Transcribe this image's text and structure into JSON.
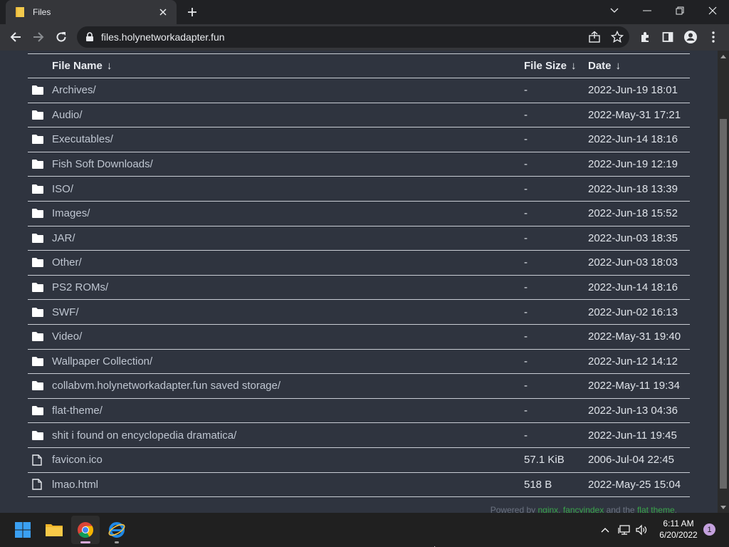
{
  "browser": {
    "tab": {
      "title": "Files"
    },
    "url": "files.holynetworkadapter.fun"
  },
  "listing": {
    "headers": {
      "name": "File Name",
      "size": "File Size",
      "date": "Date",
      "sort_arrow": "↓"
    },
    "rows": [
      {
        "type": "folder",
        "name": "Archives/",
        "size": "-",
        "date": "2022-Jun-19 18:01"
      },
      {
        "type": "folder",
        "name": "Audio/",
        "size": "-",
        "date": "2022-May-31 17:21"
      },
      {
        "type": "folder",
        "name": "Executables/",
        "size": "-",
        "date": "2022-Jun-14 18:16"
      },
      {
        "type": "folder",
        "name": "Fish Soft Downloads/",
        "size": "-",
        "date": "2022-Jun-19 12:19"
      },
      {
        "type": "folder",
        "name": "ISO/",
        "size": "-",
        "date": "2022-Jun-18 13:39"
      },
      {
        "type": "folder",
        "name": "Images/",
        "size": "-",
        "date": "2022-Jun-18 15:52"
      },
      {
        "type": "folder",
        "name": "JAR/",
        "size": "-",
        "date": "2022-Jun-03 18:35"
      },
      {
        "type": "folder",
        "name": "Other/",
        "size": "-",
        "date": "2022-Jun-03 18:03"
      },
      {
        "type": "folder",
        "name": "PS2 ROMs/",
        "size": "-",
        "date": "2022-Jun-14 18:16"
      },
      {
        "type": "folder",
        "name": "SWF/",
        "size": "-",
        "date": "2022-Jun-02 16:13"
      },
      {
        "type": "folder",
        "name": "Video/",
        "size": "-",
        "date": "2022-May-31 19:40"
      },
      {
        "type": "folder",
        "name": "Wallpaper Collection/",
        "size": "-",
        "date": "2022-Jun-12 14:12"
      },
      {
        "type": "folder",
        "name": "collabvm.holynetworkadapter.fun saved storage/",
        "size": "-",
        "date": "2022-May-11 19:34"
      },
      {
        "type": "folder",
        "name": "flat-theme/",
        "size": "-",
        "date": "2022-Jun-13 04:36"
      },
      {
        "type": "folder",
        "name": "shit i found on encyclopedia dramatica/",
        "size": "-",
        "date": "2022-Jun-11 19:45"
      },
      {
        "type": "file",
        "name": "favicon.ico",
        "size": "57.1 KiB",
        "date": "2006-Jul-04 22:45"
      },
      {
        "type": "file",
        "name": "lmao.html",
        "size": "518 B",
        "date": "2022-May-25 15:04"
      }
    ]
  },
  "footer": {
    "prefix": "Powered by",
    "link1": "nginx",
    "sep": ",",
    "link2": "fancyindex",
    "middle": "and the",
    "link3": "flat theme",
    "suffix": "."
  },
  "taskbar": {
    "time": "6:11 AM",
    "date": "6/20/2022",
    "notifications": "1"
  },
  "colors": {
    "page_bg": "#2f343f",
    "link_green": "#3aa34a",
    "chrome_frame": "#202124",
    "chrome_toolbar": "#35363a"
  }
}
